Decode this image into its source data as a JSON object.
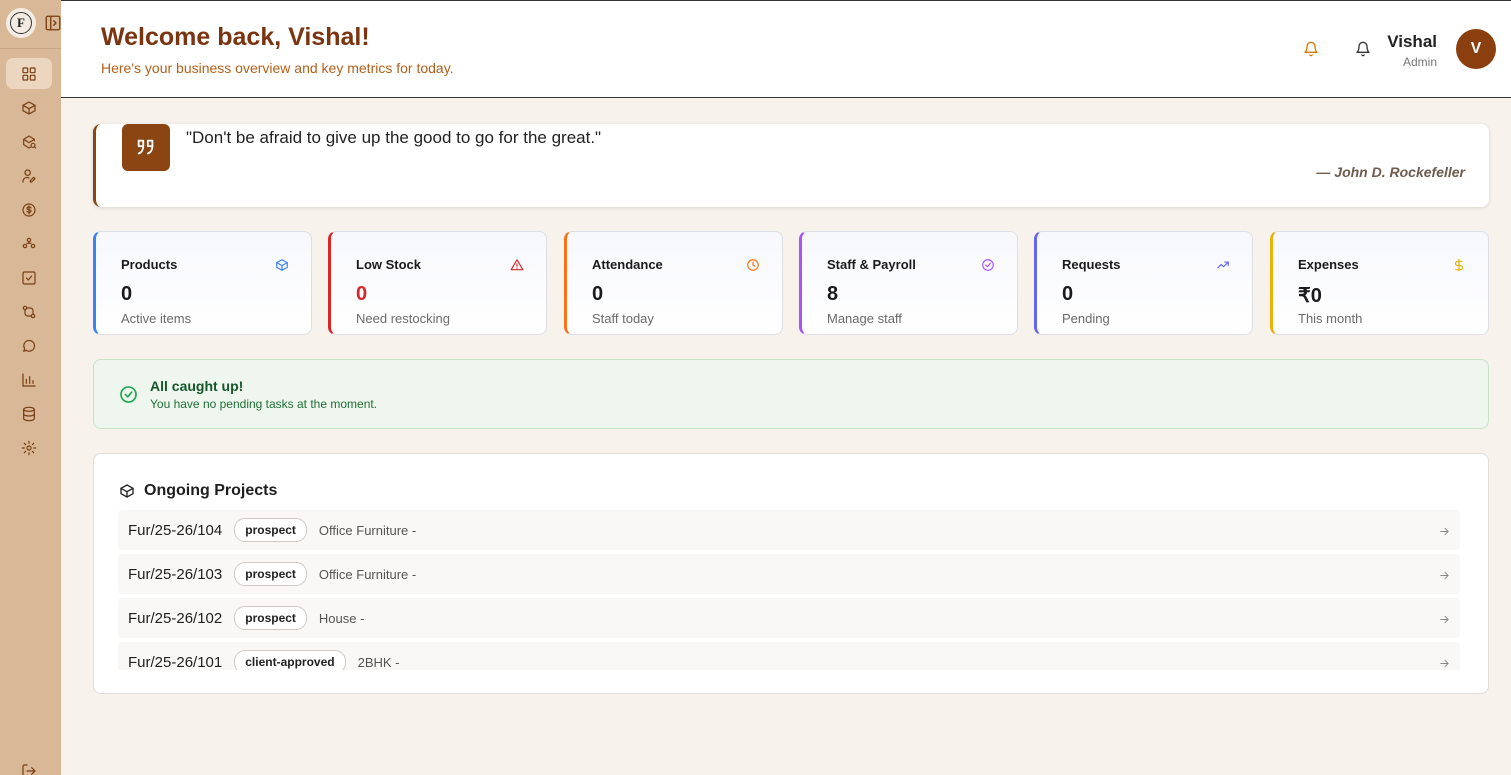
{
  "header": {
    "welcome": "Welcome back, Vishal!",
    "subtitle": "Here's your business overview and key metrics for today.",
    "user_name": "Vishal",
    "user_role": "Admin",
    "avatar_initial": "V"
  },
  "sidebar": {
    "items": [
      {
        "icon": "dashboard-icon"
      },
      {
        "icon": "box-icon"
      },
      {
        "icon": "package-search-icon"
      },
      {
        "icon": "user-edit-icon"
      },
      {
        "icon": "dollar-circle-icon"
      },
      {
        "icon": "workflow-icon"
      },
      {
        "icon": "check-square-icon"
      },
      {
        "icon": "route-icon"
      },
      {
        "icon": "chat-icon"
      },
      {
        "icon": "bar-chart-icon"
      },
      {
        "icon": "database-icon"
      },
      {
        "icon": "settings-icon"
      }
    ],
    "logo_letter": "F"
  },
  "quote": {
    "text": "\"Don't be afraid to give up the good to go for the great.\"",
    "author": "— John D. Rockefeller"
  },
  "stats": [
    {
      "title": "Products",
      "value": "0",
      "sub": "Active items",
      "color": "#3b82f6",
      "icon": "cube-icon"
    },
    {
      "title": "Low Stock",
      "value": "0",
      "sub": "Need restocking",
      "color": "#dc2626",
      "icon": "alert-triangle-icon"
    },
    {
      "title": "Attendance",
      "value": "0",
      "sub": "Staff today",
      "color": "#f97316",
      "icon": "clock-icon"
    },
    {
      "title": "Staff & Payroll",
      "value": "8",
      "sub": "Manage staff",
      "color": "#a855f7",
      "icon": "check-circle-icon"
    },
    {
      "title": "Requests",
      "value": "0",
      "sub": "Pending",
      "color": "#6366f1",
      "icon": "trending-up-icon"
    },
    {
      "title": "Expenses",
      "value": "₹0",
      "sub": "This month",
      "color": "#eab308",
      "icon": "dollar-icon"
    }
  ],
  "caught_up": {
    "title": "All caught up!",
    "subtitle": "You have no pending tasks at the moment."
  },
  "projects": {
    "title": "Ongoing Projects",
    "rows": [
      {
        "code": "Fur/25-26/104",
        "status": "prospect",
        "desc": "Office Furniture -"
      },
      {
        "code": "Fur/25-26/103",
        "status": "prospect",
        "desc": "Office Furniture -"
      },
      {
        "code": "Fur/25-26/102",
        "status": "prospect",
        "desc": "House -"
      },
      {
        "code": "Fur/25-26/101",
        "status": "client-approved",
        "desc": "2BHK -"
      }
    ]
  }
}
